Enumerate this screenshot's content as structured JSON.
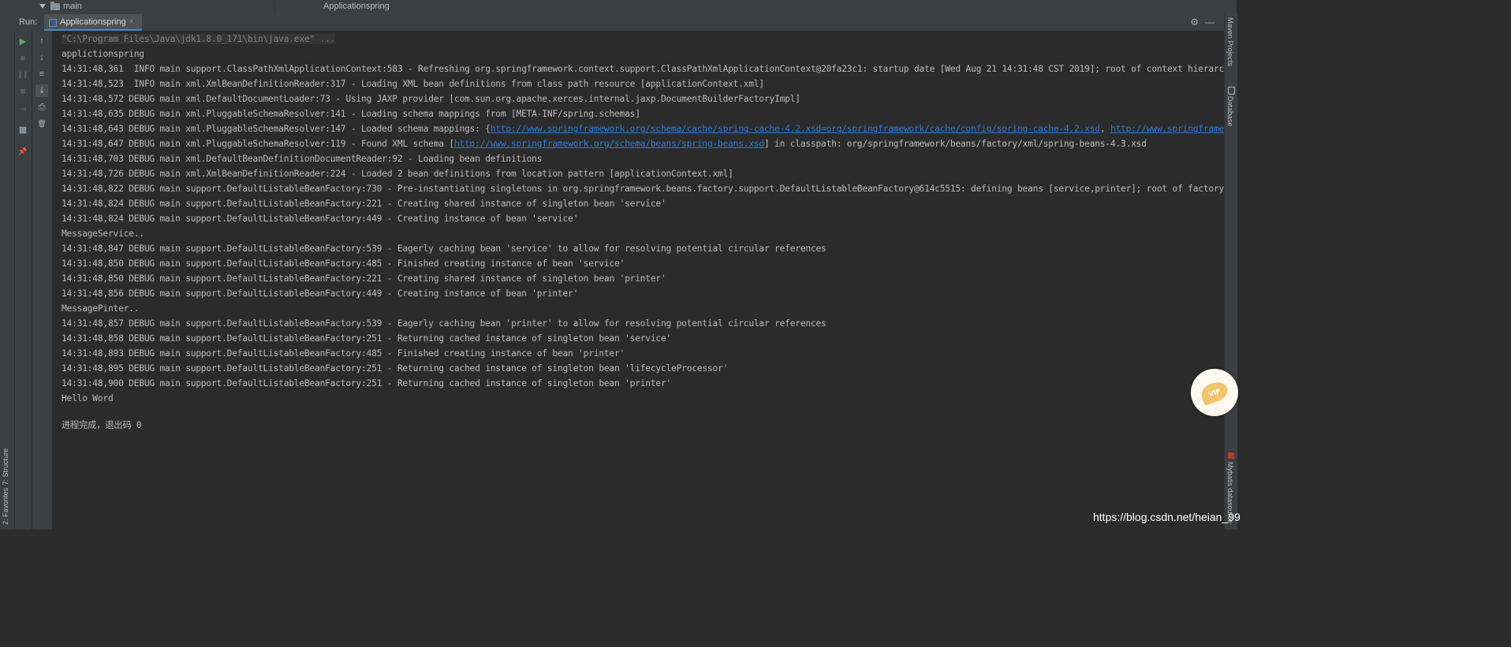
{
  "top_bar": {
    "tree_node_label": "main",
    "editor_tab_title": "Applicationspring"
  },
  "run_panel": {
    "label": "Run:",
    "tab_label": "Applicationspring",
    "tab_close": "×",
    "settings_glyph": "⚙",
    "minimize_glyph": "—"
  },
  "controls_col1": [
    {
      "icon": "play-icon",
      "glyph": "▶"
    },
    {
      "icon": "stop-icon",
      "glyph": "■"
    },
    {
      "icon": "pause-icon",
      "glyph": "❚❚"
    },
    {
      "icon": "camera-icon",
      "glyph": "◙"
    },
    {
      "icon": "exit-icon",
      "glyph": "⇥"
    },
    {
      "icon": "layout-icon",
      "glyph": "▦"
    },
    {
      "icon": "pin-icon",
      "glyph": "📌"
    }
  ],
  "controls_col2": [
    {
      "icon": "up-arrow-icon",
      "glyph": "↑"
    },
    {
      "icon": "down-arrow-icon",
      "glyph": "↓"
    },
    {
      "icon": "soft-wrap-icon",
      "glyph": "≡"
    },
    {
      "icon": "scroll-to-end-icon",
      "glyph": "⤓"
    },
    {
      "icon": "print-icon",
      "glyph": "⎙"
    },
    {
      "icon": "trash-icon",
      "glyph": "🗑"
    }
  ],
  "console": {
    "command": "\"C:\\Program Files\\Java\\jdk1.8.0_171\\bin\\java.exe\" ...",
    "lines": [
      "applictionspring",
      "14:31:48,361  INFO main support.ClassPathXmlApplicationContext:583 - Refreshing org.springframework.context.support.ClassPathXmlApplicationContext@20fa23c1: startup date [Wed Aug 21 14:31:48 CST 2019]; root of context hierarchy",
      "14:31:48,523  INFO main xml.XmlBeanDefinitionReader:317 - Loading XML bean definitions from class path resource [applicationContext.xml]",
      "14:31:48,572 DEBUG main xml.DefaultDocumentLoader:73 - Using JAXP provider [com.sun.org.apache.xerces.internal.jaxp.DocumentBuilderFactoryImpl]",
      "14:31:48,635 DEBUG main xml.PluggableSchemaResolver:141 - Loading schema mappings from [META-INF/spring.schemas]"
    ],
    "schema_mappings": {
      "prefix": "14:31:48,643 DEBUG main xml.PluggableSchemaResolver:147 - Loaded schema mappings: {",
      "link1": "http://www.springframework.org/schema/cache/spring-cache-4.2.xsd=org/springframework/cache/config/spring-cache-4.2.xsd",
      "sep": ", ",
      "link2": "http://www.springframework.org/schema/"
    },
    "found_schema": {
      "prefix": "14:31:48,647 DEBUG main xml.PluggableSchemaResolver:119 - Found XML schema [",
      "link": "http://www.springframework.org/schema/beans/spring-beans.xsd",
      "suffix": "] in classpath: org/springframework/beans/factory/xml/spring-beans-4.3.xsd"
    },
    "lines2": [
      "14:31:48,703 DEBUG main xml.DefaultBeanDefinitionDocumentReader:92 - Loading bean definitions",
      "14:31:48,726 DEBUG main xml.XmlBeanDefinitionReader:224 - Loaded 2 bean definitions from location pattern [applicationContext.xml]",
      "14:31:48,822 DEBUG main support.DefaultListableBeanFactory:730 - Pre-instantiating singletons in org.springframework.beans.factory.support.DefaultListableBeanFactory@614c5515: defining beans [service,printer]; root of factory hierarchy",
      "14:31:48,824 DEBUG main support.DefaultListableBeanFactory:221 - Creating shared instance of singleton bean 'service'",
      "14:31:48,824 DEBUG main support.DefaultListableBeanFactory:449 - Creating instance of bean 'service'",
      "MessageService..",
      "14:31:48,847 DEBUG main support.DefaultListableBeanFactory:539 - Eagerly caching bean 'service' to allow for resolving potential circular references",
      "14:31:48,850 DEBUG main support.DefaultListableBeanFactory:485 - Finished creating instance of bean 'service'",
      "14:31:48,850 DEBUG main support.DefaultListableBeanFactory:221 - Creating shared instance of singleton bean 'printer'",
      "14:31:48,856 DEBUG main support.DefaultListableBeanFactory:449 - Creating instance of bean 'printer'",
      "MessagePinter..",
      "14:31:48,857 DEBUG main support.DefaultListableBeanFactory:539 - Eagerly caching bean 'printer' to allow for resolving potential circular references",
      "14:31:48,858 DEBUG main support.DefaultListableBeanFactory:251 - Returning cached instance of singleton bean 'service'",
      "14:31:48,893 DEBUG main support.DefaultListableBeanFactory:485 - Finished creating instance of bean 'printer'",
      "14:31:48,895 DEBUG main support.DefaultListableBeanFactory:251 - Returning cached instance of singleton bean 'lifecycleProcessor'",
      "14:31:48,900 DEBUG main support.DefaultListableBeanFactory:251 - Returning cached instance of singleton bean 'printer'",
      "Hello Word"
    ],
    "exit_message": "进程完成，退出码 0"
  },
  "left_side_tabs": {
    "structure": "7: Structure",
    "favorites": "2: Favorites"
  },
  "right_side_tabs": {
    "maven": "Maven Projects",
    "database": "Database",
    "mybatis": "Mybatis datasource"
  },
  "vip_badge": {
    "text": "VIP"
  },
  "watermark": "https://blog.csdn.net/heian_99",
  "colors": {
    "background": "#2b2b2b",
    "panel": "#3c3f41",
    "text": "#bbbbbb",
    "link": "#287bde",
    "run_green": "#59a869"
  }
}
